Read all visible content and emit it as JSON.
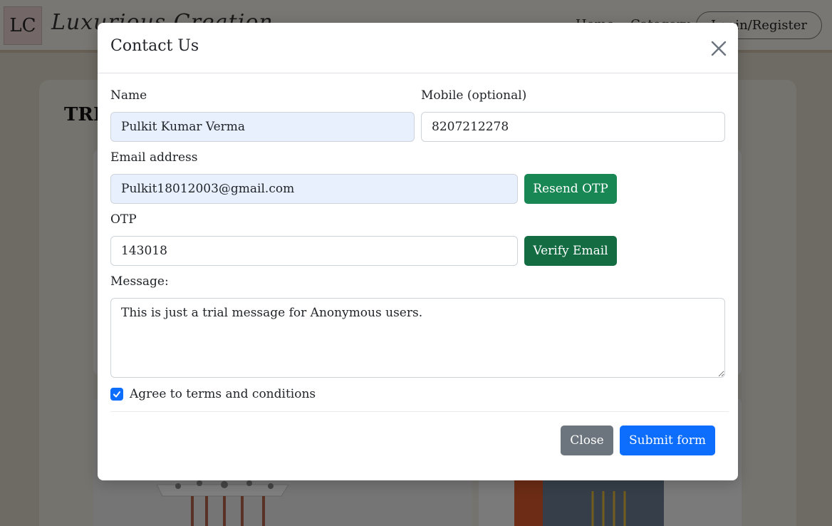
{
  "background": {
    "logo_initials": "LC",
    "logo_text": "Luxurious Creation",
    "nav": {
      "home": "Home",
      "category": "Category",
      "login": "Login/Register"
    },
    "section_title": "TRE"
  },
  "modal": {
    "title": "Contact Us",
    "name_label": "Name",
    "name_value": "Pulkit Kumar Verma",
    "mobile_label": "Mobile (optional)",
    "mobile_value": "8207212278",
    "email_label": "Email address",
    "email_value": "Pulkit18012003@gmail.com",
    "resend_otp_label": "Resend OTP",
    "otp_label": "OTP",
    "otp_value": "143018",
    "verify_email_label": "Verify Email",
    "message_label": "Message:",
    "message_value": "This is just a trial message for Anonymous users.",
    "terms_label": "Agree to terms and conditions",
    "terms_checked": true,
    "close_label": "Close",
    "submit_label": "Submit form"
  },
  "colors": {
    "primary": "#0d6efd",
    "success": "#198754",
    "success_dark": "#146c43",
    "secondary": "#6c757d",
    "autofill": "#e8f0fe"
  }
}
